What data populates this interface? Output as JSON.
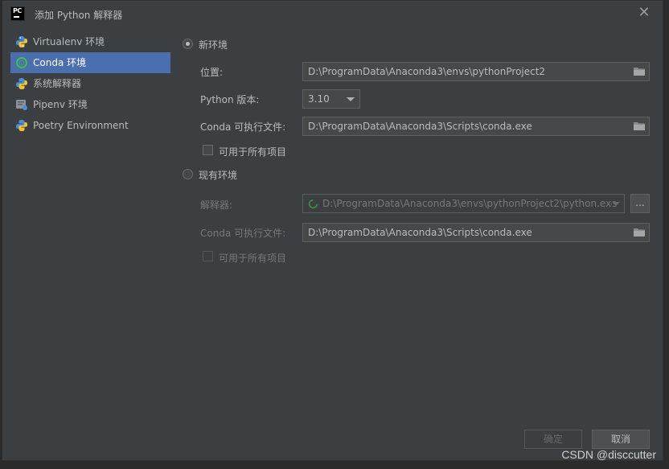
{
  "window": {
    "title": "添加 Python 解释器",
    "logo_text": "PC"
  },
  "sidebar": {
    "items": [
      {
        "label": "Virtualenv 环境",
        "icon": "python-icon",
        "selected": false
      },
      {
        "label": "Conda 环境",
        "icon": "conda-icon",
        "selected": true
      },
      {
        "label": "系统解释器",
        "icon": "python-icon",
        "selected": false
      },
      {
        "label": "Pipenv 环境",
        "icon": "pipenv-icon",
        "selected": false
      },
      {
        "label": "Poetry Environment",
        "icon": "python-icon",
        "selected": false
      }
    ]
  },
  "new_env": {
    "radio_label": "新环境",
    "location_label": "位置:",
    "location_value": "D:\\ProgramData\\Anaconda3\\envs\\pythonProject2",
    "python_version_label": "Python 版本:",
    "python_version_value": "3.10",
    "conda_exe_label": "Conda 可执行文件:",
    "conda_exe_value": "D:\\ProgramData\\Anaconda3\\Scripts\\conda.exe",
    "all_projects_label": "可用于所有项目"
  },
  "existing_env": {
    "radio_label": "现有环境",
    "interpreter_label": "解释器:",
    "interpreter_value": "D:\\ProgramData\\Anaconda3\\envs\\pythonProject2\\python.exe",
    "browse_label": "...",
    "conda_exe_label": "Conda 可执行文件:",
    "conda_exe_value": "D:\\ProgramData\\Anaconda3\\Scripts\\conda.exe",
    "all_projects_label": "可用于所有项目"
  },
  "buttons": {
    "ok": "确定",
    "cancel": "取消"
  },
  "watermark": "CSDN @disccutter",
  "colors": {
    "selection": "#4b6eaf",
    "background": "#3c3f41",
    "field": "#45494a"
  }
}
